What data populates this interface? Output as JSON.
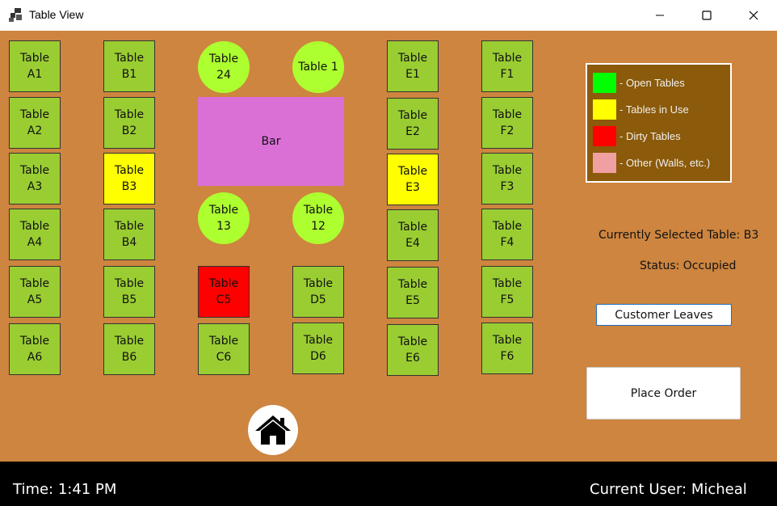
{
  "window": {
    "title": "Table View"
  },
  "tables": {
    "A1": "Table\nA1",
    "A2": "Table\nA2",
    "A3": "Table\nA3",
    "A4": "Table\nA4",
    "A5": "Table\nA5",
    "A6": "Table\nA6",
    "B1": "Table\nB1",
    "B2": "Table\nB2",
    "B3": "Table\nB3",
    "B4": "Table\nB4",
    "B5": "Table\nB5",
    "B6": "Table\nB6",
    "T24": "Table\n24",
    "T1": "Table 1",
    "T13": "Table\n13",
    "T12": "Table\n12",
    "C5": "Table\nC5",
    "C6": "Table\nC6",
    "D5": "Table\nD5",
    "D6": "Table\nD6",
    "E1": "Table\nE1",
    "E2": "Table\nE2",
    "E3": "Table\nE3",
    "E4": "Table\nE4",
    "E5": "Table\nE5",
    "E6": "Table\nE6",
    "F1": "Table\nF1",
    "F2": "Table\nF2",
    "F3": "Table\nF3",
    "F4": "Table\nF4",
    "F5": "Table\nF5",
    "F6": "Table\nF6"
  },
  "bar": {
    "label": "Bar"
  },
  "legend": {
    "open": "- Open Tables",
    "inuse": "- Tables in Use",
    "dirty": "- Dirty Tables",
    "other": "- Other (Walls, etc.)",
    "colors": {
      "open": "#00ff00",
      "inuse": "#ffff00",
      "dirty": "#ff0000",
      "other": "#f0a0a0"
    }
  },
  "selection": {
    "selected": "Currently Selected Table: B3",
    "status": "Status: Occupied"
  },
  "buttons": {
    "customer_leaves": "Customer Leaves",
    "place_order": "Place Order"
  },
  "statusbar": {
    "time": "Time: 1:41 PM",
    "user": "Current User: Micheal"
  },
  "icons": {
    "app": "table-view-app-icon",
    "home": "home-icon"
  }
}
